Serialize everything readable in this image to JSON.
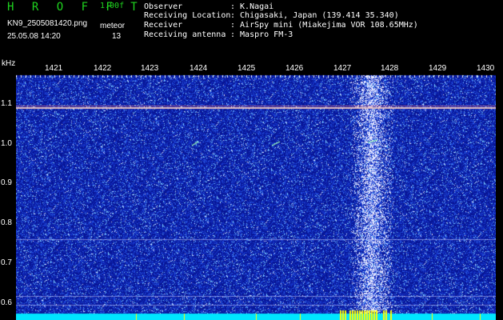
{
  "header": {
    "app_logo": "H R O F F T",
    "version": "1.00f",
    "file_name": "KN9_2505081420.png",
    "mode": "meteor",
    "datetime": "25.05.08 14:20",
    "count": "13"
  },
  "station": {
    "rows": [
      {
        "key": "Observer",
        "value": ": K.Nagai"
      },
      {
        "key": "Receiving Location",
        "value": ": Chigasaki, Japan (139.414 35.340)"
      },
      {
        "key": "Receiver",
        "value": ": AirSpy mini (Miakejima VOR 108.65MHz)"
      },
      {
        "key": "Receiving antenna",
        "value": ": Maspro FM-3"
      }
    ]
  },
  "axes": {
    "y_unit": "kHz",
    "y_ticks": [
      "1.1",
      "1.0",
      "0.9",
      "0.8",
      "0.7",
      "0.6"
    ],
    "x_ticks": [
      "1421",
      "1422",
      "1423",
      "1424",
      "1425",
      "1426",
      "1427",
      "1428",
      "1429",
      "1430"
    ]
  },
  "colors": {
    "background": "#000000",
    "logo": "#1fd41f",
    "noise_base": "#1a2ab8",
    "carrier_line": "#e8c0c0",
    "bottom_band": "#00e5ff",
    "bottom_hits": "#ffff00"
  }
}
